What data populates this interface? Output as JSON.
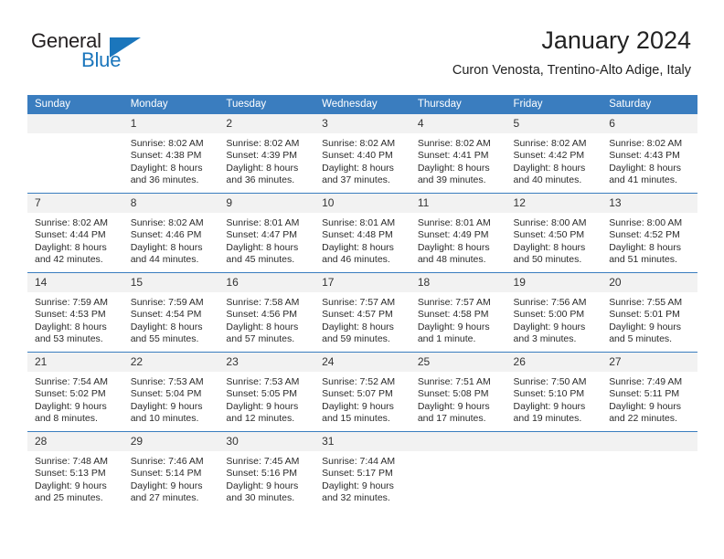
{
  "brand": {
    "word_one": "General",
    "word_two": "Blue",
    "colors": {
      "dark": "#231f20",
      "blue": "#1b76bc"
    }
  },
  "header": {
    "title": "January 2024",
    "subtitle": "Curon Venosta, Trentino-Alto Adige, Italy"
  },
  "calendar": {
    "header_bg": "#3a7dbf",
    "daynum_bg": "#f2f2f2",
    "weekday_headers": [
      "Sunday",
      "Monday",
      "Tuesday",
      "Wednesday",
      "Thursday",
      "Friday",
      "Saturday"
    ],
    "weeks": [
      [
        {
          "day": "",
          "empty": true,
          "sunrise": "",
          "sunset": "",
          "daylight_1": "",
          "daylight_2": ""
        },
        {
          "day": "1",
          "sunrise": "Sunrise: 8:02 AM",
          "sunset": "Sunset: 4:38 PM",
          "daylight_1": "Daylight: 8 hours",
          "daylight_2": "and 36 minutes."
        },
        {
          "day": "2",
          "sunrise": "Sunrise: 8:02 AM",
          "sunset": "Sunset: 4:39 PM",
          "daylight_1": "Daylight: 8 hours",
          "daylight_2": "and 36 minutes."
        },
        {
          "day": "3",
          "sunrise": "Sunrise: 8:02 AM",
          "sunset": "Sunset: 4:40 PM",
          "daylight_1": "Daylight: 8 hours",
          "daylight_2": "and 37 minutes."
        },
        {
          "day": "4",
          "sunrise": "Sunrise: 8:02 AM",
          "sunset": "Sunset: 4:41 PM",
          "daylight_1": "Daylight: 8 hours",
          "daylight_2": "and 39 minutes."
        },
        {
          "day": "5",
          "sunrise": "Sunrise: 8:02 AM",
          "sunset": "Sunset: 4:42 PM",
          "daylight_1": "Daylight: 8 hours",
          "daylight_2": "and 40 minutes."
        },
        {
          "day": "6",
          "sunrise": "Sunrise: 8:02 AM",
          "sunset": "Sunset: 4:43 PM",
          "daylight_1": "Daylight: 8 hours",
          "daylight_2": "and 41 minutes."
        }
      ],
      [
        {
          "day": "7",
          "sunrise": "Sunrise: 8:02 AM",
          "sunset": "Sunset: 4:44 PM",
          "daylight_1": "Daylight: 8 hours",
          "daylight_2": "and 42 minutes."
        },
        {
          "day": "8",
          "sunrise": "Sunrise: 8:02 AM",
          "sunset": "Sunset: 4:46 PM",
          "daylight_1": "Daylight: 8 hours",
          "daylight_2": "and 44 minutes."
        },
        {
          "day": "9",
          "sunrise": "Sunrise: 8:01 AM",
          "sunset": "Sunset: 4:47 PM",
          "daylight_1": "Daylight: 8 hours",
          "daylight_2": "and 45 minutes."
        },
        {
          "day": "10",
          "sunrise": "Sunrise: 8:01 AM",
          "sunset": "Sunset: 4:48 PM",
          "daylight_1": "Daylight: 8 hours",
          "daylight_2": "and 46 minutes."
        },
        {
          "day": "11",
          "sunrise": "Sunrise: 8:01 AM",
          "sunset": "Sunset: 4:49 PM",
          "daylight_1": "Daylight: 8 hours",
          "daylight_2": "and 48 minutes."
        },
        {
          "day": "12",
          "sunrise": "Sunrise: 8:00 AM",
          "sunset": "Sunset: 4:50 PM",
          "daylight_1": "Daylight: 8 hours",
          "daylight_2": "and 50 minutes."
        },
        {
          "day": "13",
          "sunrise": "Sunrise: 8:00 AM",
          "sunset": "Sunset: 4:52 PM",
          "daylight_1": "Daylight: 8 hours",
          "daylight_2": "and 51 minutes."
        }
      ],
      [
        {
          "day": "14",
          "sunrise": "Sunrise: 7:59 AM",
          "sunset": "Sunset: 4:53 PM",
          "daylight_1": "Daylight: 8 hours",
          "daylight_2": "and 53 minutes."
        },
        {
          "day": "15",
          "sunrise": "Sunrise: 7:59 AM",
          "sunset": "Sunset: 4:54 PM",
          "daylight_1": "Daylight: 8 hours",
          "daylight_2": "and 55 minutes."
        },
        {
          "day": "16",
          "sunrise": "Sunrise: 7:58 AM",
          "sunset": "Sunset: 4:56 PM",
          "daylight_1": "Daylight: 8 hours",
          "daylight_2": "and 57 minutes."
        },
        {
          "day": "17",
          "sunrise": "Sunrise: 7:57 AM",
          "sunset": "Sunset: 4:57 PM",
          "daylight_1": "Daylight: 8 hours",
          "daylight_2": "and 59 minutes."
        },
        {
          "day": "18",
          "sunrise": "Sunrise: 7:57 AM",
          "sunset": "Sunset: 4:58 PM",
          "daylight_1": "Daylight: 9 hours",
          "daylight_2": "and 1 minute."
        },
        {
          "day": "19",
          "sunrise": "Sunrise: 7:56 AM",
          "sunset": "Sunset: 5:00 PM",
          "daylight_1": "Daylight: 9 hours",
          "daylight_2": "and 3 minutes."
        },
        {
          "day": "20",
          "sunrise": "Sunrise: 7:55 AM",
          "sunset": "Sunset: 5:01 PM",
          "daylight_1": "Daylight: 9 hours",
          "daylight_2": "and 5 minutes."
        }
      ],
      [
        {
          "day": "21",
          "sunrise": "Sunrise: 7:54 AM",
          "sunset": "Sunset: 5:02 PM",
          "daylight_1": "Daylight: 9 hours",
          "daylight_2": "and 8 minutes."
        },
        {
          "day": "22",
          "sunrise": "Sunrise: 7:53 AM",
          "sunset": "Sunset: 5:04 PM",
          "daylight_1": "Daylight: 9 hours",
          "daylight_2": "and 10 minutes."
        },
        {
          "day": "23",
          "sunrise": "Sunrise: 7:53 AM",
          "sunset": "Sunset: 5:05 PM",
          "daylight_1": "Daylight: 9 hours",
          "daylight_2": "and 12 minutes."
        },
        {
          "day": "24",
          "sunrise": "Sunrise: 7:52 AM",
          "sunset": "Sunset: 5:07 PM",
          "daylight_1": "Daylight: 9 hours",
          "daylight_2": "and 15 minutes."
        },
        {
          "day": "25",
          "sunrise": "Sunrise: 7:51 AM",
          "sunset": "Sunset: 5:08 PM",
          "daylight_1": "Daylight: 9 hours",
          "daylight_2": "and 17 minutes."
        },
        {
          "day": "26",
          "sunrise": "Sunrise: 7:50 AM",
          "sunset": "Sunset: 5:10 PM",
          "daylight_1": "Daylight: 9 hours",
          "daylight_2": "and 19 minutes."
        },
        {
          "day": "27",
          "sunrise": "Sunrise: 7:49 AM",
          "sunset": "Sunset: 5:11 PM",
          "daylight_1": "Daylight: 9 hours",
          "daylight_2": "and 22 minutes."
        }
      ],
      [
        {
          "day": "28",
          "sunrise": "Sunrise: 7:48 AM",
          "sunset": "Sunset: 5:13 PM",
          "daylight_1": "Daylight: 9 hours",
          "daylight_2": "and 25 minutes."
        },
        {
          "day": "29",
          "sunrise": "Sunrise: 7:46 AM",
          "sunset": "Sunset: 5:14 PM",
          "daylight_1": "Daylight: 9 hours",
          "daylight_2": "and 27 minutes."
        },
        {
          "day": "30",
          "sunrise": "Sunrise: 7:45 AM",
          "sunset": "Sunset: 5:16 PM",
          "daylight_1": "Daylight: 9 hours",
          "daylight_2": "and 30 minutes."
        },
        {
          "day": "31",
          "sunrise": "Sunrise: 7:44 AM",
          "sunset": "Sunset: 5:17 PM",
          "daylight_1": "Daylight: 9 hours",
          "daylight_2": "and 32 minutes."
        },
        {
          "day": "",
          "empty": true,
          "sunrise": "",
          "sunset": "",
          "daylight_1": "",
          "daylight_2": ""
        },
        {
          "day": "",
          "empty": true,
          "sunrise": "",
          "sunset": "",
          "daylight_1": "",
          "daylight_2": ""
        },
        {
          "day": "",
          "empty": true,
          "sunrise": "",
          "sunset": "",
          "daylight_1": "",
          "daylight_2": ""
        }
      ]
    ]
  }
}
